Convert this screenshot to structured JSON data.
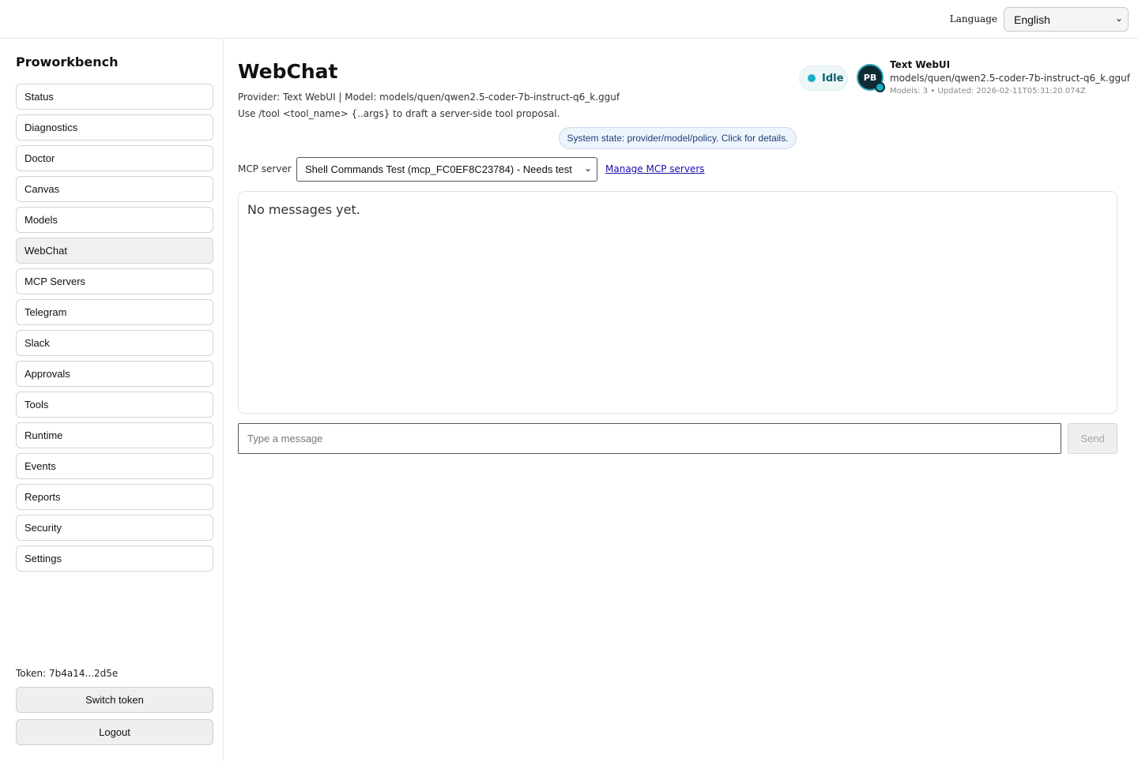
{
  "header": {
    "language_label": "Language",
    "language_value": "English"
  },
  "sidebar": {
    "brand": "Proworkbench",
    "items": [
      {
        "label": "Status"
      },
      {
        "label": "Diagnostics"
      },
      {
        "label": "Doctor"
      },
      {
        "label": "Canvas"
      },
      {
        "label": "Models"
      },
      {
        "label": "WebChat",
        "active": true
      },
      {
        "label": "MCP Servers"
      },
      {
        "label": "Telegram"
      },
      {
        "label": "Slack"
      },
      {
        "label": "Approvals"
      },
      {
        "label": "Tools"
      },
      {
        "label": "Runtime"
      },
      {
        "label": "Events"
      },
      {
        "label": "Reports"
      },
      {
        "label": "Security"
      },
      {
        "label": "Settings"
      }
    ],
    "token_text": "Token: 7b4a14...2d5e",
    "switch_token_label": "Switch token",
    "logout_label": "Logout"
  },
  "main": {
    "title": "WebChat",
    "provider_line": "Provider: Text WebUI | Model: models/quen/qwen2.5-coder-7b-instruct-q6_k.gguf",
    "hint_line": "Use /tool <tool_name> {..args} to draft a server-side tool proposal.",
    "status": "Idle",
    "status_color": "#17b0c4",
    "avatar_initials": "PB",
    "provider_name": "Text WebUI",
    "provider_model": "models/quen/qwen2.5-coder-7b-instruct-q6_k.gguf",
    "provider_meta": "Models: 3 • Updated: 2026-02-11T05:31:20.074Z",
    "system_state": "System state: provider/model/policy. Click for details.",
    "mcp_label": "MCP server",
    "mcp_selected": "Shell Commands Test (mcp_FC0EF8C23784) - Needs test",
    "mcp_manage_link": "Manage MCP servers",
    "empty_message": "No messages yet.",
    "input_placeholder": "Type a message",
    "input_value": "",
    "send_label": "Send"
  }
}
